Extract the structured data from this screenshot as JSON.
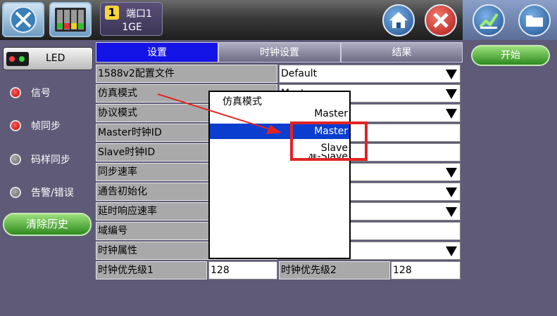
{
  "top_bar": {
    "port_number": "1",
    "port_title": "端口1",
    "port_subtitle": "1GE",
    "icons": [
      "wrench-icon",
      "meter-icon",
      "home-icon",
      "close-icon",
      "chart-icon",
      "folder-icon"
    ]
  },
  "left_panel": {
    "led_button_label": "LED",
    "indicators": [
      {
        "label": "信号",
        "state": "red"
      },
      {
        "label": "帧同步",
        "state": "red"
      },
      {
        "label": "码样同步",
        "state": "gray"
      },
      {
        "label": "告警/错误",
        "state": "gray"
      }
    ],
    "clear_history_label": "清除历史"
  },
  "right_panel": {
    "start_label": "开始"
  },
  "tabs": [
    {
      "label": "设置",
      "active": true
    },
    {
      "label": "时钟设置",
      "active": false
    },
    {
      "label": "结果",
      "active": false
    }
  ],
  "rows": [
    {
      "label": "1588v2配置文件",
      "value": "Default",
      "dropdown": true
    },
    {
      "label": "仿真模式",
      "value": "Master",
      "dropdown": true
    },
    {
      "label": "协议模式",
      "value": "",
      "dropdown": true
    },
    {
      "label": "Master时钟ID",
      "value": "",
      "dropdown": false
    },
    {
      "label": "Slave时钟ID",
      "value": "",
      "dropdown": false
    },
    {
      "label": "同步速率",
      "value": "",
      "dropdown": true
    },
    {
      "label": "通告初始化",
      "value": "",
      "dropdown": true
    },
    {
      "label": "延时响应速率",
      "value": "",
      "dropdown": true
    },
    {
      "label": "域编号",
      "value": "",
      "dropdown": false
    },
    {
      "label": "时钟属性",
      "value": "",
      "dropdown": true
    }
  ],
  "last_row": {
    "label1": "时钟优先级1",
    "value1": "128",
    "label2": "时钟优先级2",
    "value2": "128"
  },
  "popup": {
    "title": "仿真模式",
    "current": "Master",
    "options": [
      "Master",
      "Slave",
      "准-Slave"
    ],
    "selected": "Master"
  },
  "colors": {
    "active_tab": "#1414e6",
    "selection": "#0b3ecf",
    "annotation": "#e02424",
    "button_green": "#2d8a1e"
  }
}
